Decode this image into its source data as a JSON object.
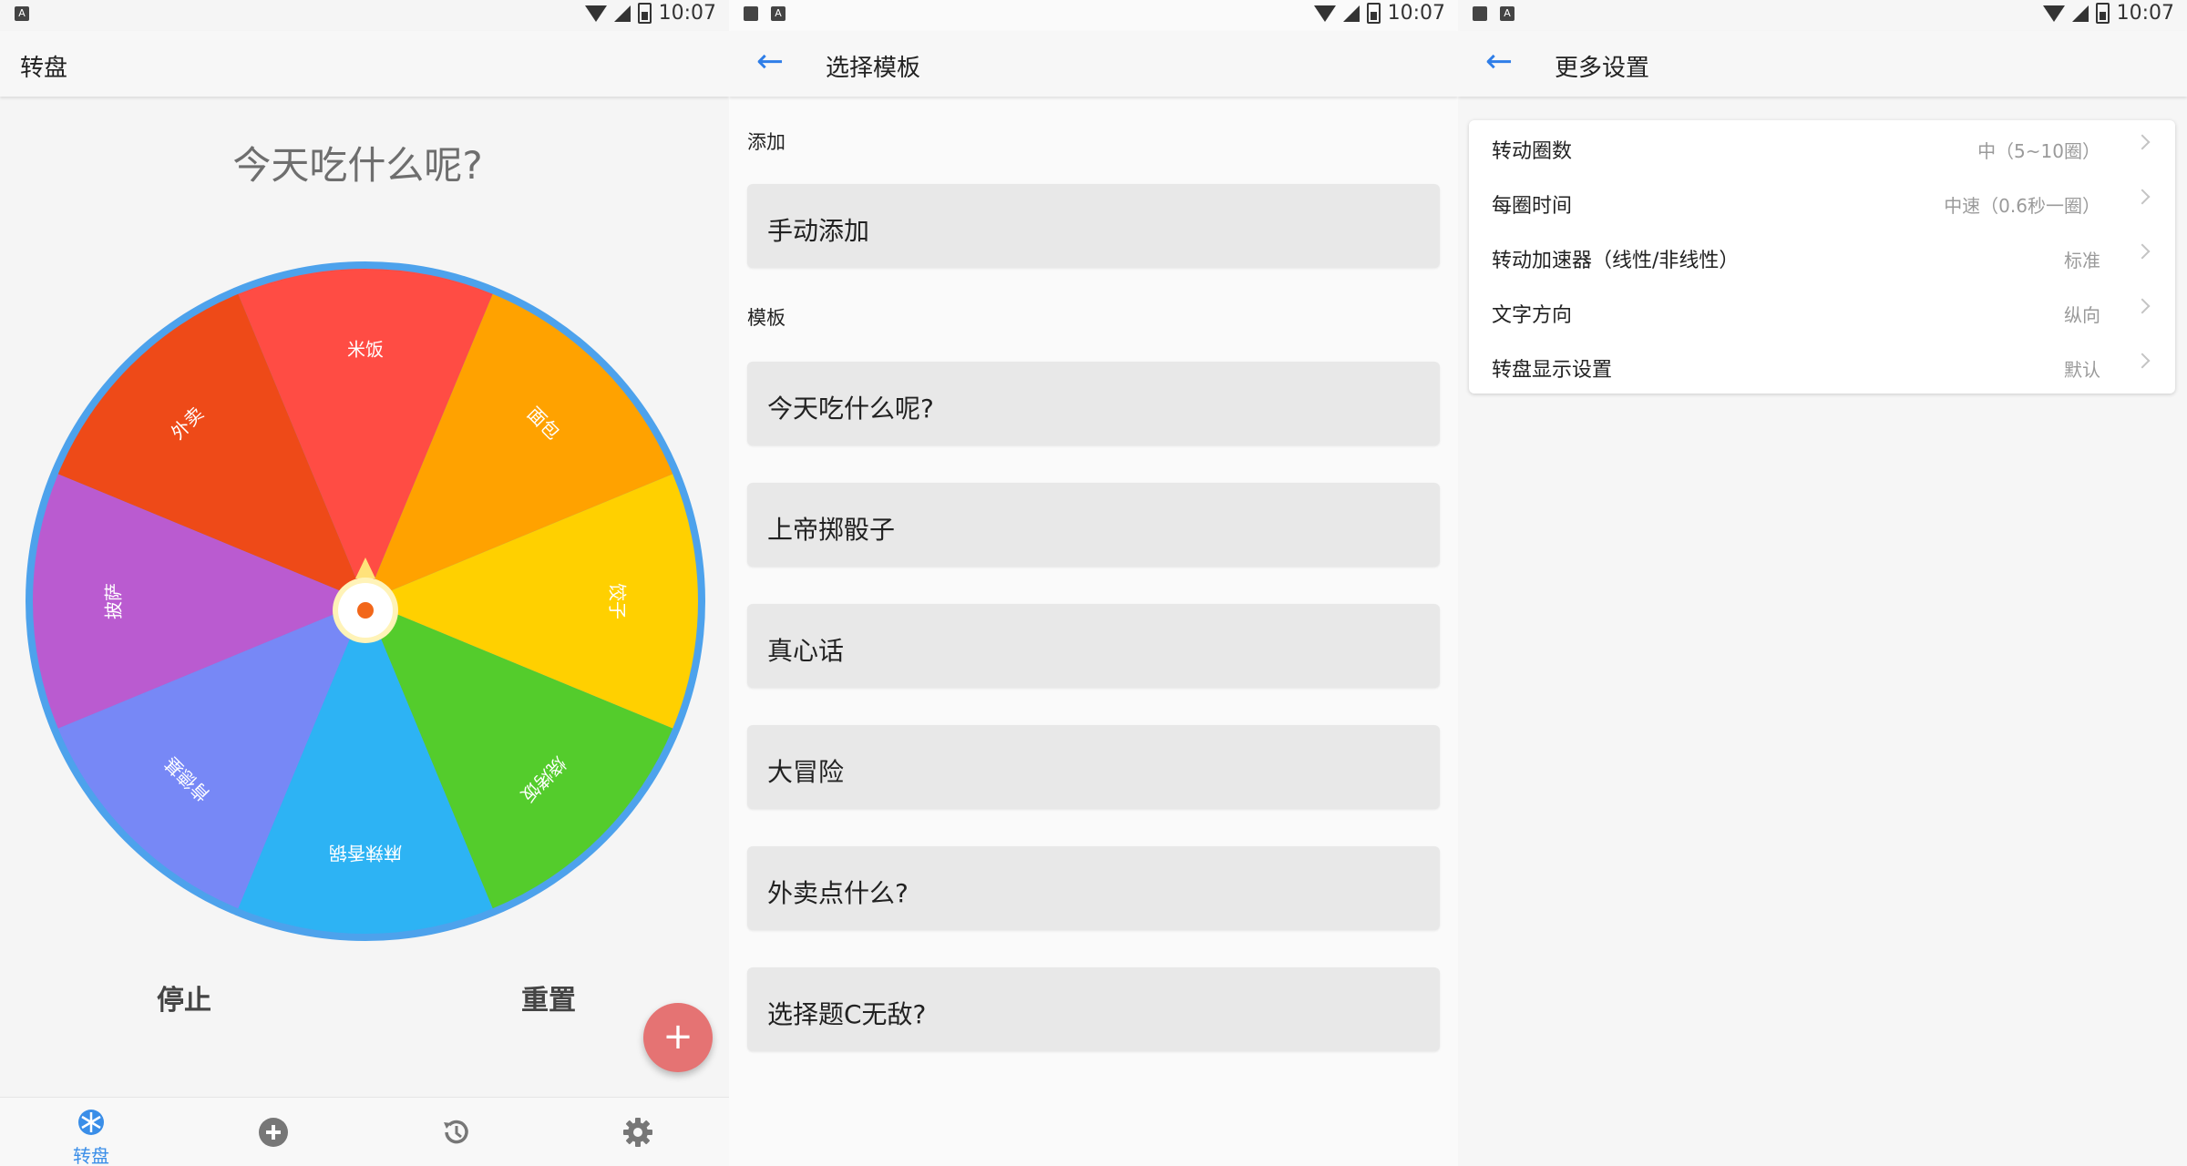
{
  "status": {
    "time": "10:07",
    "small_icon": "A"
  },
  "screen1": {
    "title": "转盘",
    "question": "今天吃什么呢?",
    "stop_label": "停止",
    "reset_label": "重置",
    "fab_icon": "+",
    "segments": [
      {
        "label": "米饭",
        "color": "#FF4C44"
      },
      {
        "label": "面包",
        "color": "#FFA200"
      },
      {
        "label": "饺子",
        "color": "#FFD000"
      },
      {
        "label": "烧烤饭",
        "color": "#54CC2C"
      },
      {
        "label": "麻辣香锅",
        "color": "#2DB3F4"
      },
      {
        "label": "肯德基",
        "color": "#7788F6"
      },
      {
        "label": "披萨",
        "color": "#BA5BD0"
      },
      {
        "label": "外卖",
        "color": "#EE4A18"
      }
    ],
    "rim_color": "#4DA2EC",
    "nav": {
      "wheel_label": "转盘",
      "wheel_icon": "snowflake-icon",
      "add_icon": "plus-circle-icon",
      "history_icon": "history-icon",
      "settings_icon": "gear-icon"
    }
  },
  "screen2": {
    "title": "选择模板",
    "add_section": "添加",
    "manual_add": "手动添加",
    "template_section": "模板",
    "templates": [
      "今天吃什么呢?",
      "上帝掷骰子",
      "真心话",
      "大冒险",
      "外卖点什么?",
      "选择题C无敌?"
    ]
  },
  "screen3": {
    "title": "更多设置",
    "rows": [
      {
        "label": "转动圈数",
        "value": "中（5~10圈）"
      },
      {
        "label": "每圈时间",
        "value": "中速（0.6秒一圈）"
      },
      {
        "label": "转动加速器（线性/非线性）",
        "value": "标准"
      },
      {
        "label": "文字方向",
        "value": "纵向"
      },
      {
        "label": "转盘显示设置",
        "value": "默认"
      }
    ]
  }
}
